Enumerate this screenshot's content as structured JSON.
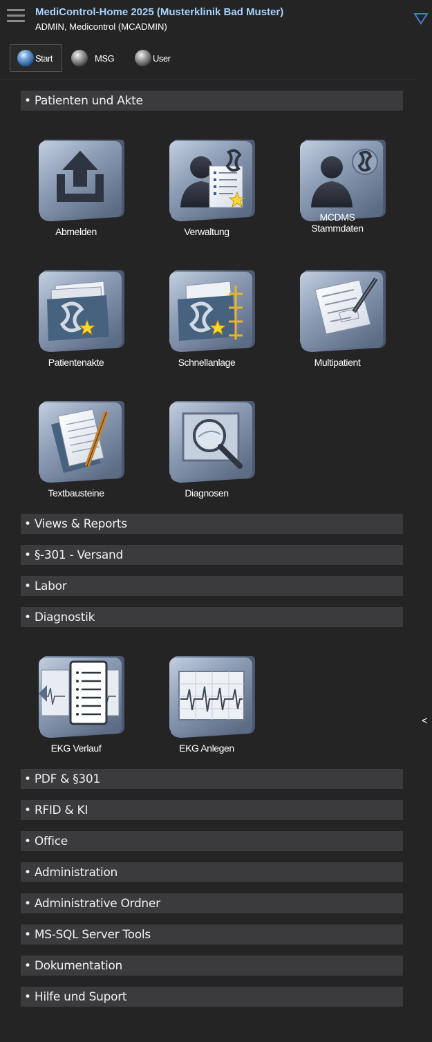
{
  "header": {
    "title": "MediControl-Home 2025 (Musterklinik Bad Muster)",
    "user": "ADMIN, Medicontrol (MCADMIN)",
    "menu_icon": "hamburger-icon",
    "dropdown_icon": "triangle-down-icon"
  },
  "modes": [
    {
      "label": "Start",
      "active": true
    },
    {
      "label": "MSG",
      "active": false
    },
    {
      "label": "User",
      "active": false
    }
  ],
  "sections": {
    "patienten": "• Patienten und Akte",
    "views": "• Views & Reports",
    "versand": "• §-301 - Versand",
    "labor": "• Labor",
    "diagnostik": "• Diagnostik",
    "pdf": "• PDF & §301",
    "rfid": "• RFID & KI",
    "office": "• Office",
    "administration": "• Administration",
    "admin_ordner": "• Administrative Ordner",
    "mssql": "• MS-SQL Server Tools",
    "dokumentation": "• Dokumentation",
    "hilfe": "• Hilfe und Suport"
  },
  "tiles": {
    "abmelden": {
      "label": "Abmelden",
      "icon": "logout-upload-icon"
    },
    "verwaltung": {
      "label": "Verwaltung",
      "icon": "patient-admin-icon"
    },
    "stammdaten": {
      "label": "MCDMS\nStammdaten",
      "icon": "patient-masterdata-icon"
    },
    "patientenakte": {
      "label": "Patientenakte",
      "icon": "patient-folder-icon"
    },
    "schnellanlage": {
      "label": "Schnellanlage",
      "icon": "quick-create-folder-icon"
    },
    "multipatient": {
      "label": "Multipatient",
      "icon": "form-pen-icon"
    },
    "textbausteine": {
      "label": "Textbausteine",
      "icon": "notepad-pencil-icon"
    },
    "diagnosen": {
      "label": "Diagnosen",
      "icon": "magnifier-screen-icon"
    },
    "ekg_verlauf": {
      "label": "EKG Verlauf",
      "icon": "ecg-history-icon"
    },
    "ekg_anlegen": {
      "label": "EKG Anlegen",
      "icon": "ecg-create-icon"
    }
  },
  "side_toggle": "<",
  "colors": {
    "background": "#242424",
    "section_bar": "#3b3b3d",
    "title": "#a8d4ff",
    "accent": "#3d7bd6"
  }
}
